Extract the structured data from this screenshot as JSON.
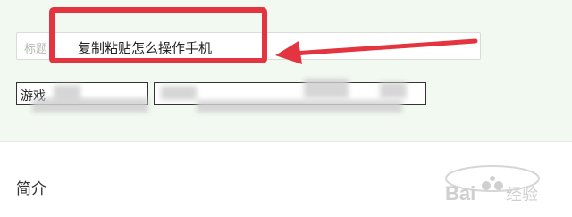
{
  "form": {
    "title_placeholder": "标题",
    "title_value": "复制粘贴怎么操作手机",
    "game_select_label": "游戏"
  },
  "section": {
    "intro_heading": "简介"
  },
  "annotation": {
    "highlight_color": "#e3343f"
  },
  "watermark": {
    "text": "Baidu经验"
  }
}
